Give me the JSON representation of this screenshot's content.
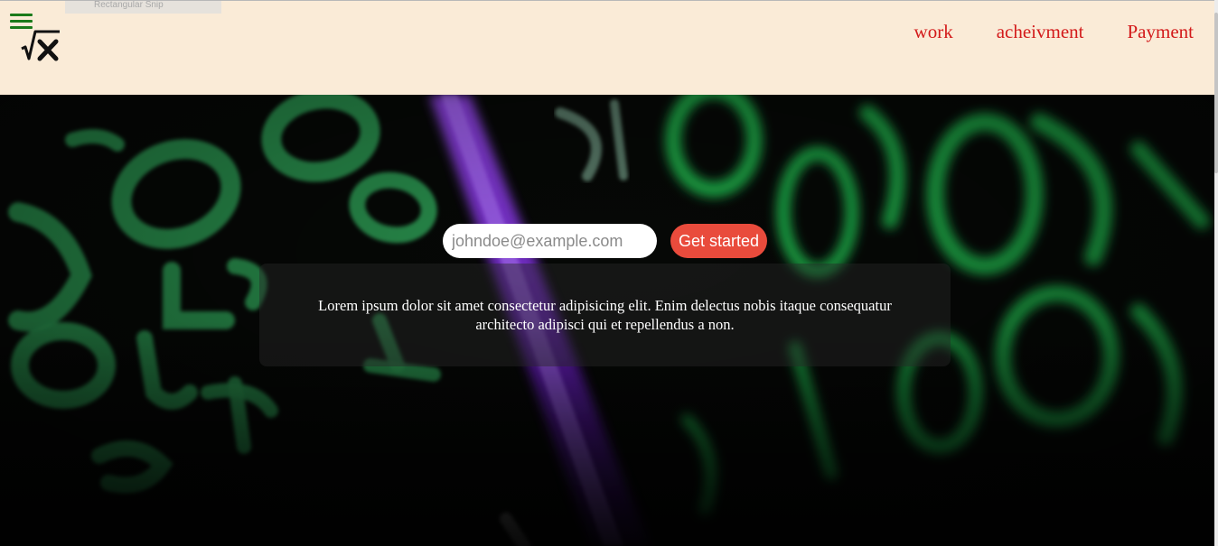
{
  "snip_tab": {
    "label": "Rectangular Snip"
  },
  "header": {
    "nav": [
      {
        "label": "work"
      },
      {
        "label": "acheivment"
      },
      {
        "label": "Payment"
      }
    ]
  },
  "hero": {
    "email_placeholder": "johndoe@example.com",
    "cta_label": "Get started",
    "description": "Lorem ipsum dolor sit amet consectetur adipisicing elit. Enim delectus nobis itaque consequatur architecto adipisci qui et repellendus a non."
  },
  "colors": {
    "header_bg": "#faebd7",
    "nav_link": "#d31a1a",
    "menu_icon": "#1a7a1a",
    "cta_bg": "#e94b3c",
    "chalk_green": "#2fbf5a",
    "accent_purple": "#7b2bd6"
  },
  "icons": {
    "menu": "hamburger-icon",
    "logo": "square-root-x-logo"
  }
}
